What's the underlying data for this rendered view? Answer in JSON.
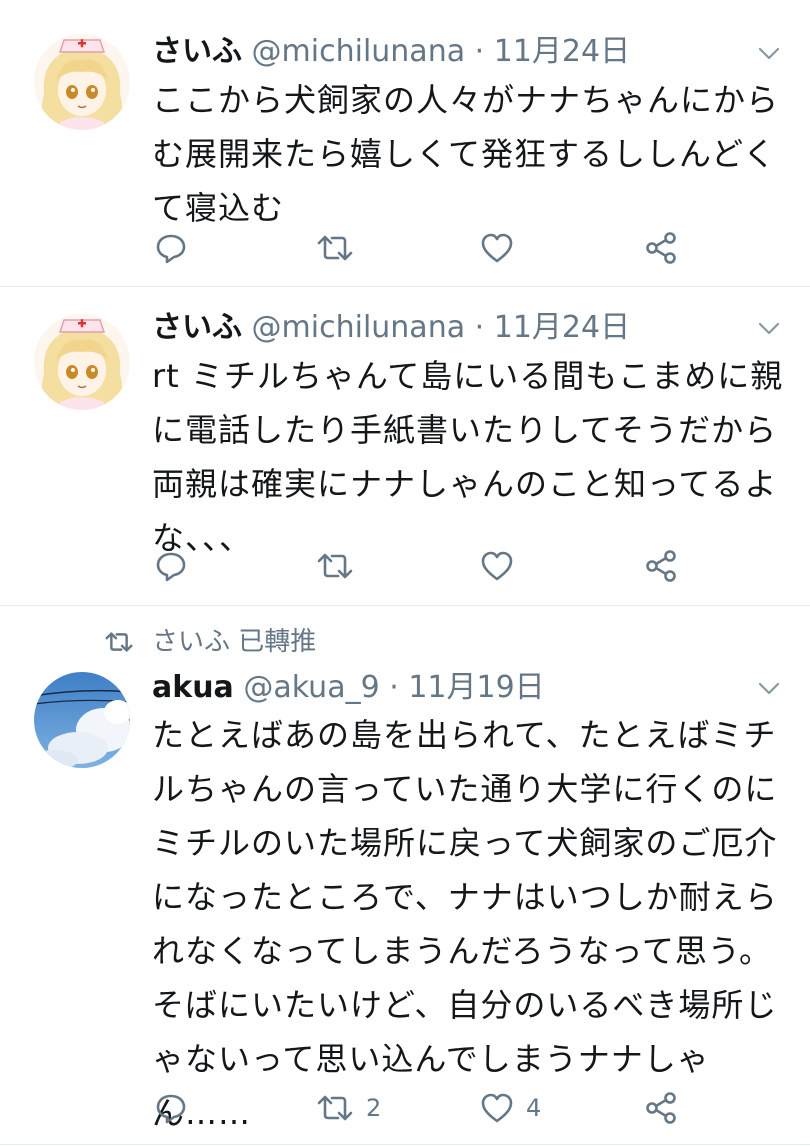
{
  "tweets": [
    {
      "name": "さいふ",
      "handle": "@michilunana",
      "dot": "·",
      "date": "11月24日",
      "text": "ここから犬飼家の人々がナナちゃんにからむ展開来たら嬉しくて発狂するししんどくて寝込む",
      "reply_count": "",
      "retweet_count": "",
      "like_count": ""
    },
    {
      "name": "さいふ",
      "handle": "@michilunana",
      "dot": "·",
      "date": "11月24日",
      "text": "rt ミチルちゃんて島にいる間もこまめに親に電話したり手紙書いたりしてそうだから両親は確実にナナしゃんのこと知ってるよな、、、",
      "reply_count": "",
      "retweet_count": "",
      "like_count": ""
    },
    {
      "retweeted_by": "さいふ 已轉推",
      "name": "akua",
      "handle": "@akua_9",
      "dot": "·",
      "date": "11月19日",
      "text": "たとえばあの島を出られて、たとえばミチルちゃんの言っていた通り大学に行くのにミチルのいた場所に戻って犬飼家のご厄介になったところで、ナナはいつしか耐えられなくなってしまうんだろうなって思う。そばにいたいけど、自分のいるべき場所じゃないって思い込んでしまうナナしゃん……",
      "reply_count": "",
      "retweet_count": "2",
      "like_count": "4"
    }
  ],
  "icons": {
    "reply": "reply-icon",
    "retweet": "retweet-icon",
    "like": "heart-icon",
    "share": "share-icon",
    "more": "chevron-down-icon"
  },
  "colors": {
    "icon": "#657786",
    "divider": "#e6ecf0",
    "text": "#14171a"
  }
}
